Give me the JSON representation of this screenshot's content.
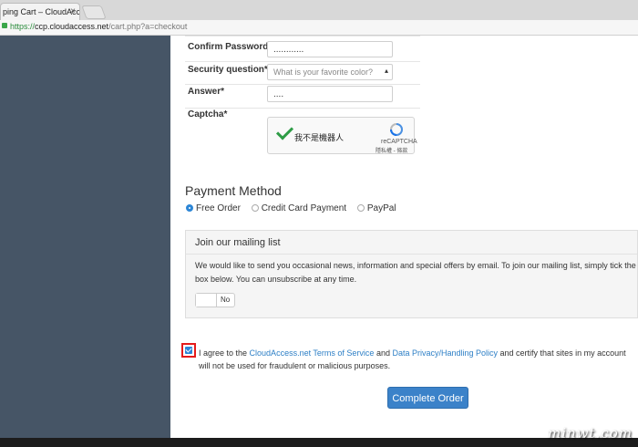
{
  "browser": {
    "tab_title": "ping Cart – CloudAccess...",
    "tab_close": "×",
    "url_scheme": "https://",
    "url_host": "ccp.cloudaccess.net",
    "url_path": "/cart.php?a=checkout"
  },
  "form": {
    "confirm_password_label": "Confirm Password*",
    "confirm_password_value": "............",
    "security_question_label": "Security question*",
    "security_question_value": "What is your favorite color?",
    "answer_label": "Answer*",
    "answer_value": "....",
    "captcha_label": "Captcha*"
  },
  "captcha": {
    "text": "我不是機器人",
    "brand": "reCAPTCHA",
    "links": "隱私權 - 條款"
  },
  "payment": {
    "title": "Payment Method",
    "options": [
      {
        "label": "Free Order",
        "selected": true
      },
      {
        "label": "Credit Card Payment",
        "selected": false
      },
      {
        "label": "PayPal",
        "selected": false
      }
    ]
  },
  "mailing": {
    "title": "Join our mailing list",
    "body": "We would like to send you occasional news, information and special offers by email. To join our mailing list, simply tick the box below. You can unsubscribe at any time.",
    "toggle_label": "No"
  },
  "agree": {
    "checked": true,
    "text_1": "I agree to the ",
    "tos_link": "CloudAccess.net Terms of Service",
    "text_2": " and ",
    "privacy_link": "Data Privacy/Handling Policy",
    "text_3": " and certify that sites in my account will not be used for fraudulent or malicious purposes."
  },
  "submit_label": "Complete Order",
  "watermark": "minwt.com",
  "colors": {
    "sidebar": "#465566",
    "accent": "#3b82c9",
    "highlight": "#e41b1b"
  }
}
